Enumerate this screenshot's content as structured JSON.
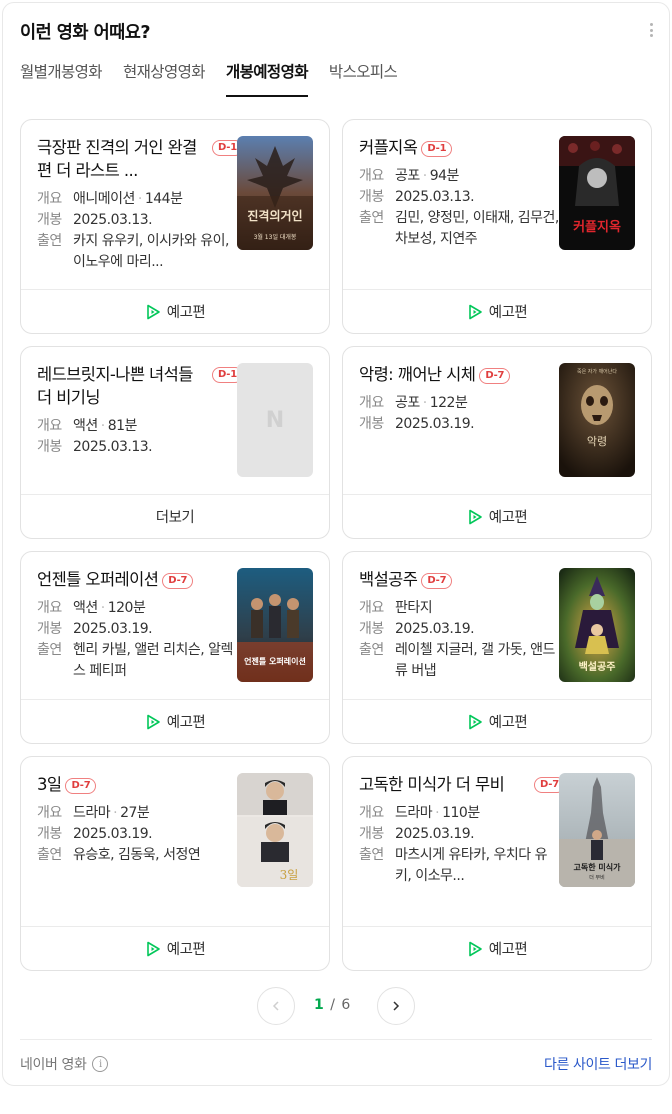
{
  "header": {
    "title": "이런 영화 어때요?",
    "more_icon": "kebab-icon"
  },
  "tabs": [
    {
      "label": "월별개봉영화",
      "active": false
    },
    {
      "label": "현재상영영화",
      "active": false
    },
    {
      "label": "개봉예정영화",
      "active": true
    },
    {
      "label": "박스오피스",
      "active": false
    }
  ],
  "labels": {
    "genre": "개요",
    "release": "개봉",
    "cast": "출연"
  },
  "movies": [
    {
      "title": "극장판 진격의 거인 완결편 더 라스트 ...",
      "dday": "D-1",
      "genre": "애니메이션",
      "runtime": "144분",
      "release": "2025.03.13.",
      "cast": "카지 유우키, 이시카와 유이, 이노우에 마리...",
      "action": "예고편"
    },
    {
      "title": "커플지옥",
      "dday": "D-1",
      "genre": "공포",
      "runtime": "94분",
      "release": "2025.03.13.",
      "cast": "김민, 양정민, 이태재, 김무건, 차보성, 지연주",
      "action": "예고편"
    },
    {
      "title": "레드브릿지-나쁜 녀석들 더 비기닝",
      "dday": "D-1",
      "genre": "액션",
      "runtime": "81분",
      "release": "2025.03.13.",
      "action": "더보기",
      "poster_placeholder": "N"
    },
    {
      "title": "악령: 깨어난 시체",
      "dday": "D-7",
      "genre": "공포",
      "runtime": "122분",
      "release": "2025.03.19.",
      "action": "예고편"
    },
    {
      "title": "언젠틀 오퍼레이션",
      "dday": "D-7",
      "genre": "액션",
      "runtime": "120분",
      "release": "2025.03.19.",
      "cast": "헨리 카빌, 앨런 리치슨, 알렉스 페티퍼",
      "action": "예고편"
    },
    {
      "title": "백설공주",
      "dday": "D-7",
      "genre": "판타지",
      "release": "2025.03.19.",
      "cast": "레이첼 지글러, 갤 가돗, 앤드류 버냅",
      "action": "예고편"
    },
    {
      "title": "3일",
      "dday": "D-7",
      "genre": "드라마",
      "runtime": "27분",
      "release": "2025.03.19.",
      "cast": "유승호, 김동욱, 서정연",
      "action": "예고편"
    },
    {
      "title": "고독한 미식가 더 무비",
      "dday": "D-7",
      "genre": "드라마",
      "runtime": "110분",
      "release": "2025.03.19.",
      "cast": "마츠시게 유타카, 우치다 유키, 이소무...",
      "action": "예고편"
    }
  ],
  "posters": {
    "p0": "진격의거인",
    "p0_sub": "3월 13일 대개봉",
    "p1": "커플지옥",
    "p3": "악령",
    "p3_top": "죽은 자가 깨어난다",
    "p4": "언젠틀 오퍼레이션",
    "p5": "백설공주",
    "p6": "3일",
    "p7": "고독한 미식가",
    "p7_sub": "더 무비"
  },
  "pagination": {
    "current": "1",
    "separator": "/",
    "total": "6"
  },
  "footer": {
    "source": "네이버 영화",
    "more_sites": "다른 사이트 더보기"
  }
}
